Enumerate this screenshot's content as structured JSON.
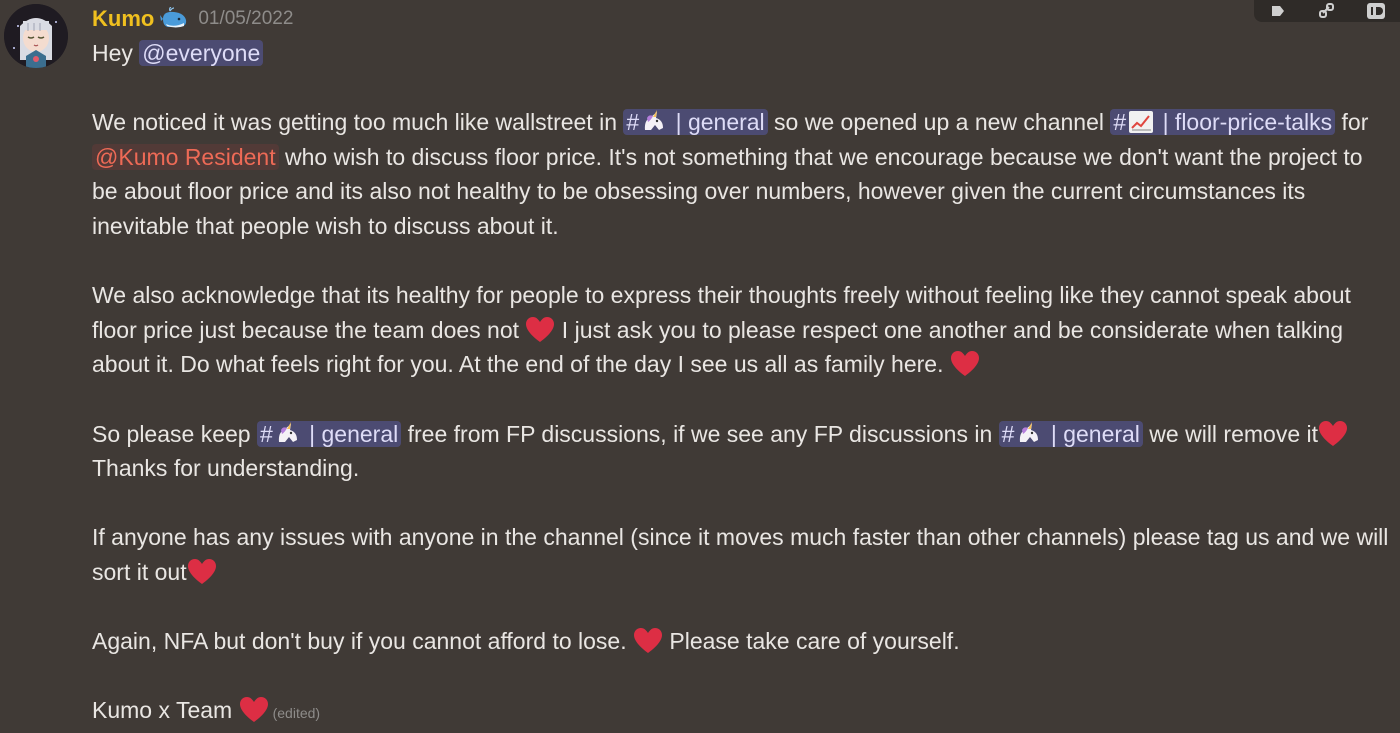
{
  "message": {
    "author": "Kumo",
    "timestamp": "01/05/2022",
    "edited_label": "(edited)"
  },
  "mentions": {
    "everyone": "@everyone",
    "role_resident": "@Kumo Resident"
  },
  "channels": {
    "general": "| general",
    "floor_price_talks": "| floor-price-talks"
  },
  "text": {
    "p1_hey": "Hey ",
    "p2_a": "We noticed it was getting too much like wallstreet in ",
    "p2_b": " so we opened up a new channel ",
    "p2_c": " for ",
    "p2_d": " who wish to discuss floor price. It's not something that we encourage because we don't want the project to be about floor price and its also not healthy to be obsessing over numbers, however given the current circumstances its inevitable that people wish to discuss about it.",
    "p3_a": "We also acknowledge that its healthy for people to express their thoughts freely without feeling like they cannot speak about floor price just because the team does not ",
    "p3_b": " I just ask you to please respect one another and be considerate when talking about it. Do what feels right for you. At the end of the day I see us all as family here. ",
    "p4_a": "So please keep ",
    "p4_b": " free from FP discussions, if we see any FP discussions in ",
    "p4_c": " we will remove it",
    "p4_d": "Thanks for understanding.",
    "p5_a": "If anyone has any issues with anyone in the channel (since it moves much faster than other channels) please tag us and we will sort it out",
    "p6_a": "Again, NFA but don't buy if you cannot afford to lose. ",
    "p6_b": " Please take care of yourself.",
    "p7_a": "Kumo x Team "
  },
  "colors": {
    "username": "#f0c01f",
    "heart": "#dd2e44",
    "mention_bg": "#4c4b72",
    "role_mention": "#ee6a56"
  },
  "icons": [
    "whale-emoji",
    "unicorn-emoji",
    "chart-emoji",
    "heart-emoji"
  ]
}
